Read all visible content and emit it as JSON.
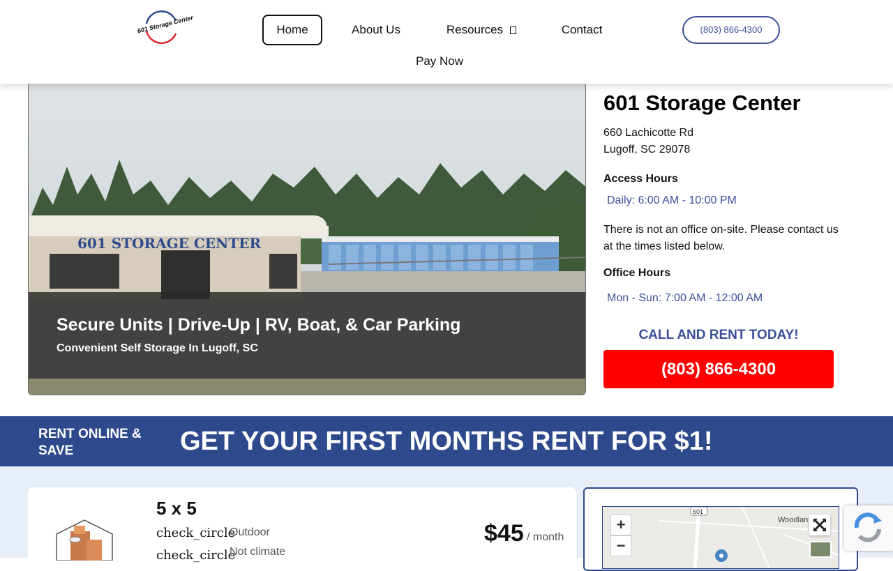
{
  "header": {
    "logo_text": "601 Storage Center",
    "nav": {
      "home": "Home",
      "about": "About Us",
      "resources": "Resources",
      "contact": "Contact",
      "pay_now": "Pay Now"
    },
    "phone": "(803) 866-4300"
  },
  "hero": {
    "sign_text": "601 STORAGE CENTER",
    "title": "Secure Units | Drive-Up | RV, Boat, & Car Parking",
    "subtitle": "Convenient Self Storage In Lugoff, SC"
  },
  "info": {
    "name": "601 Storage Center",
    "address_line1": "660 Lachicotte Rd",
    "address_line2": "Lugoff, SC 29078",
    "access_label": "Access Hours",
    "access_hours": "Daily: 6:00 AM - 10:00 PM",
    "note": "There is not an office on-site. Please contact us at the times listed below.",
    "office_label": "Office Hours",
    "office_hours": "Mon - Sun: 7:00 AM - 12:00 AM",
    "call_today": "CALL AND RENT TODAY!",
    "call_phone": "(803) 866-4300"
  },
  "promo": {
    "left": "RENT ONLINE & SAVE",
    "main": "GET YOUR FIRST MONTHS RENT FOR $1!"
  },
  "unit": {
    "size": "5 x 5",
    "features": [
      {
        "icon": "check_circle",
        "text": "Outdoor"
      },
      {
        "icon": "check_circle",
        "text": "Not climate"
      }
    ],
    "price": "$45",
    "per": "/ month"
  },
  "map": {
    "zoom_in": "+",
    "zoom_out": "−",
    "route_label": "601",
    "place_label": "Woodlan"
  },
  "colors": {
    "brand_blue": "#2e4a8c",
    "accent_red": "#ff0000",
    "link_blue": "#3b4f9a"
  }
}
